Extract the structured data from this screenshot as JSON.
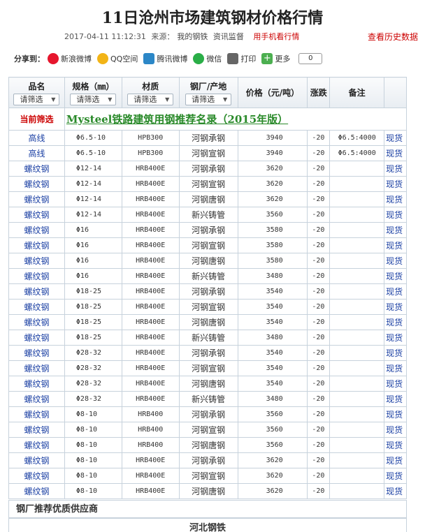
{
  "page": {
    "title": "11日沧州市场建筑钢材价格行情",
    "datetime": "2017-04-11 11:12:31",
    "source_label": "来源：",
    "source": "我的钢铁",
    "supervision": "资讯监督",
    "mobile_link": "用手机看行情",
    "history_link": "查看历史数据"
  },
  "share": {
    "label": "分享到：",
    "items": [
      {
        "label": "新浪微博",
        "icon": "weibo-icon"
      },
      {
        "label": "QQ空间",
        "icon": "qzone-icon"
      },
      {
        "label": "腾讯微博",
        "icon": "tencent-weibo-icon"
      },
      {
        "label": "微信",
        "icon": "wechat-icon"
      },
      {
        "label": "打印",
        "icon": "print-icon"
      },
      {
        "label": "更多",
        "icon": "plus-icon"
      }
    ],
    "count": "0"
  },
  "table": {
    "headers": {
      "pinming": "品名",
      "guige": "规格（㎜）",
      "caizhi": "材质",
      "chandi": "钢厂/产地",
      "price": "价格（元/吨）",
      "change": "涨跌",
      "note": "备注"
    },
    "filter_placeholder": "请筛选",
    "current_filter": "当前筛选",
    "banner": "Mysteel铁路建筑用钢推荐名录（2015年版）",
    "rows": [
      {
        "pm": "高线",
        "gg": "Φ6.5-10",
        "cz": "HPB300",
        "cd": "河钢承钢",
        "price": "3940",
        "chg": "-20",
        "note": "Φ6.5:4000",
        "stock": "现货"
      },
      {
        "pm": "高线",
        "gg": "Φ6.5-10",
        "cz": "HPB300",
        "cd": "河钢宣钢",
        "price": "3940",
        "chg": "-20",
        "note": "Φ6.5:4000",
        "stock": "现货"
      },
      {
        "pm": "螺纹钢",
        "gg": "Φ12-14",
        "cz": "HRB400E",
        "cd": "河钢承钢",
        "price": "3620",
        "chg": "-20",
        "note": "",
        "stock": "现货"
      },
      {
        "pm": "螺纹钢",
        "gg": "Φ12-14",
        "cz": "HRB400E",
        "cd": "河钢宣钢",
        "price": "3620",
        "chg": "-20",
        "note": "",
        "stock": "现货"
      },
      {
        "pm": "螺纹钢",
        "gg": "Φ12-14",
        "cz": "HRB400E",
        "cd": "河钢唐钢",
        "price": "3620",
        "chg": "-20",
        "note": "",
        "stock": "现货"
      },
      {
        "pm": "螺纹钢",
        "gg": "Φ12-14",
        "cz": "HRB400E",
        "cd": "新兴铸管",
        "price": "3560",
        "chg": "-20",
        "note": "",
        "stock": "现货"
      },
      {
        "pm": "螺纹钢",
        "gg": "Φ16",
        "cz": "HRB400E",
        "cd": "河钢承钢",
        "price": "3580",
        "chg": "-20",
        "note": "",
        "stock": "现货"
      },
      {
        "pm": "螺纹钢",
        "gg": "Φ16",
        "cz": "HRB400E",
        "cd": "河钢宣钢",
        "price": "3580",
        "chg": "-20",
        "note": "",
        "stock": "现货"
      },
      {
        "pm": "螺纹钢",
        "gg": "Φ16",
        "cz": "HRB400E",
        "cd": "河钢唐钢",
        "price": "3580",
        "chg": "-20",
        "note": "",
        "stock": "现货"
      },
      {
        "pm": "螺纹钢",
        "gg": "Φ16",
        "cz": "HRB400E",
        "cd": "新兴铸管",
        "price": "3480",
        "chg": "-20",
        "note": "",
        "stock": "现货"
      },
      {
        "pm": "螺纹钢",
        "gg": "Φ18-25",
        "cz": "HRB400E",
        "cd": "河钢承钢",
        "price": "3540",
        "chg": "-20",
        "note": "",
        "stock": "现货"
      },
      {
        "pm": "螺纹钢",
        "gg": "Φ18-25",
        "cz": "HRB400E",
        "cd": "河钢宣钢",
        "price": "3540",
        "chg": "-20",
        "note": "",
        "stock": "现货"
      },
      {
        "pm": "螺纹钢",
        "gg": "Φ18-25",
        "cz": "HRB400E",
        "cd": "河钢唐钢",
        "price": "3540",
        "chg": "-20",
        "note": "",
        "stock": "现货"
      },
      {
        "pm": "螺纹钢",
        "gg": "Φ18-25",
        "cz": "HRB400E",
        "cd": "新兴铸管",
        "price": "3480",
        "chg": "-20",
        "note": "",
        "stock": "现货"
      },
      {
        "pm": "螺纹钢",
        "gg": "Φ28-32",
        "cz": "HRB400E",
        "cd": "河钢承钢",
        "price": "3540",
        "chg": "-20",
        "note": "",
        "stock": "现货"
      },
      {
        "pm": "螺纹钢",
        "gg": "Φ28-32",
        "cz": "HRB400E",
        "cd": "河钢宣钢",
        "price": "3540",
        "chg": "-20",
        "note": "",
        "stock": "现货"
      },
      {
        "pm": "螺纹钢",
        "gg": "Φ28-32",
        "cz": "HRB400E",
        "cd": "河钢唐钢",
        "price": "3540",
        "chg": "-20",
        "note": "",
        "stock": "现货"
      },
      {
        "pm": "螺纹钢",
        "gg": "Φ28-32",
        "cz": "HRB400E",
        "cd": "新兴铸管",
        "price": "3480",
        "chg": "-20",
        "note": "",
        "stock": "现货"
      },
      {
        "pm": "螺纹钢",
        "gg": "Φ8-10",
        "cz": "HRB400",
        "cd": "河钢承钢",
        "price": "3560",
        "chg": "-20",
        "note": "",
        "stock": "现货"
      },
      {
        "pm": "螺纹钢",
        "gg": "Φ8-10",
        "cz": "HRB400",
        "cd": "河钢宣钢",
        "price": "3560",
        "chg": "-20",
        "note": "",
        "stock": "现货"
      },
      {
        "pm": "螺纹钢",
        "gg": "Φ8-10",
        "cz": "HRB400",
        "cd": "河钢唐钢",
        "price": "3560",
        "chg": "-20",
        "note": "",
        "stock": "现货"
      },
      {
        "pm": "螺纹钢",
        "gg": "Φ8-10",
        "cz": "HRB400E",
        "cd": "河钢承钢",
        "price": "3620",
        "chg": "-20",
        "note": "",
        "stock": "现货"
      },
      {
        "pm": "螺纹钢",
        "gg": "Φ8-10",
        "cz": "HRB400E",
        "cd": "河钢宣钢",
        "price": "3620",
        "chg": "-20",
        "note": "",
        "stock": "现货"
      },
      {
        "pm": "螺纹钢",
        "gg": "Φ8-10",
        "cz": "HRB400E",
        "cd": "河钢唐钢",
        "price": "3620",
        "chg": "-20",
        "note": "",
        "stock": "现货"
      }
    ]
  },
  "supplier": {
    "title": "钢厂推荐优质供应商",
    "first": "河北钢铁"
  }
}
